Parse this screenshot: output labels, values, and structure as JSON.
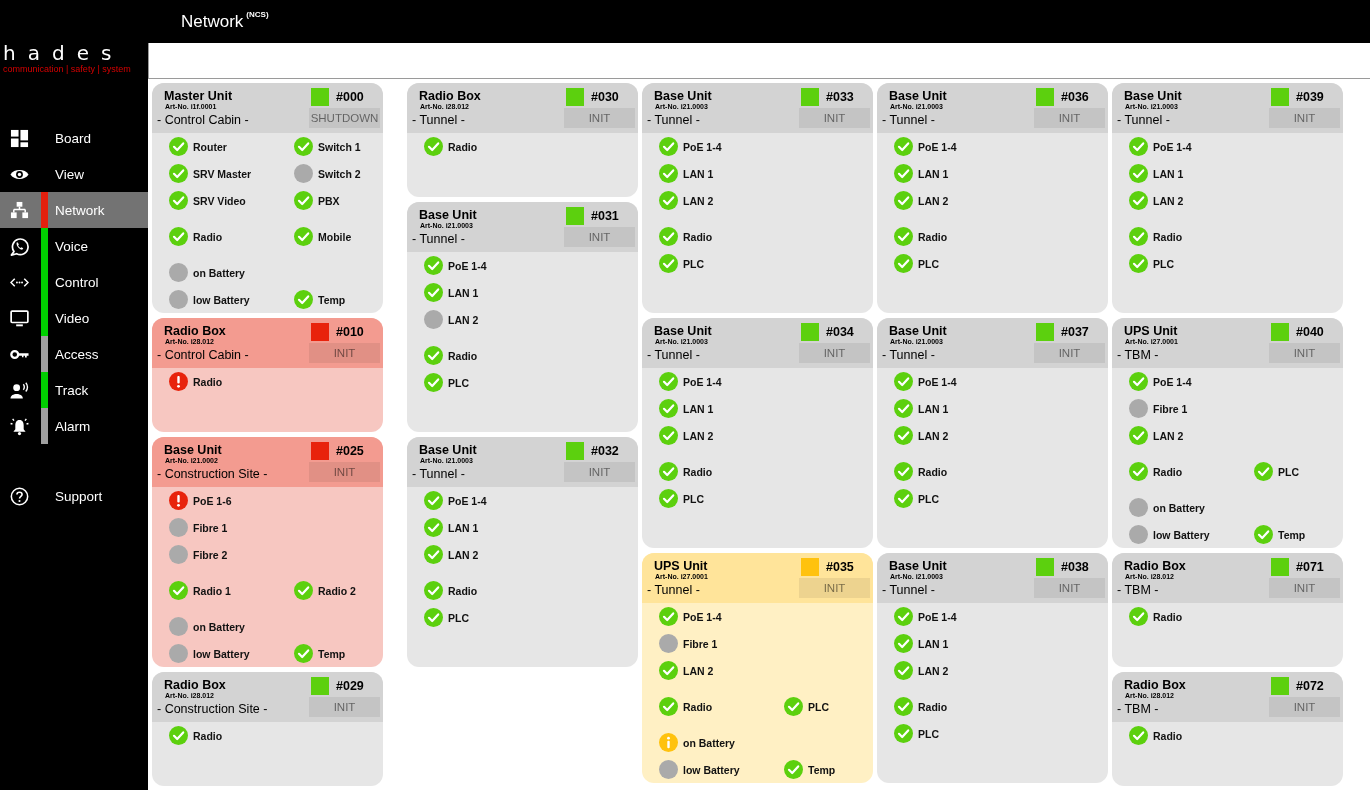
{
  "header": {
    "title": "Network",
    "title_suffix": "(NCS)"
  },
  "sidebar": {
    "logo": {
      "wordmark": "hades",
      "tagline": "communication | safety | system"
    },
    "items": [
      {
        "label": "Board",
        "selected": false
      },
      {
        "label": "View",
        "selected": false
      },
      {
        "label": "Network",
        "selected": true,
        "color": "#e3200e"
      },
      {
        "label": "Voice",
        "selected": false,
        "color": "#00d000"
      },
      {
        "label": "Control",
        "selected": false,
        "color": "#00d000"
      },
      {
        "label": "Video",
        "selected": false,
        "color": "#00d000"
      },
      {
        "label": "Access",
        "selected": false,
        "color": "#a0a0a0"
      },
      {
        "label": "Track",
        "selected": false,
        "color": "#00d000"
      },
      {
        "label": "Alarm",
        "selected": false,
        "color": "#a0a0a0"
      }
    ],
    "support": {
      "label": "Support"
    }
  },
  "columns": [
    {
      "cards": [
        {
          "title": "Master Unit",
          "art_no": "Art-No. i1f.0001",
          "location": "- Control Cabin -",
          "number": "#000",
          "kind": "ok",
          "button": "SHUTDOWN",
          "groups": [
            {
              "rows": [
                [
                  {
                    "label": "Router",
                    "kind": "ok"
                  },
                  {
                    "label": "Switch 1",
                    "kind": "ok"
                  }
                ],
                [
                  {
                    "label": "SRV Master",
                    "kind": "ok"
                  },
                  {
                    "label": "Switch 2",
                    "kind": "off"
                  }
                ],
                [
                  {
                    "label": "SRV Video",
                    "kind": "ok"
                  },
                  {
                    "label": "PBX",
                    "kind": "ok"
                  }
                ]
              ]
            },
            {
              "rows": [
                [
                  {
                    "label": "Radio",
                    "kind": "ok"
                  },
                  {
                    "label": "Mobile",
                    "kind": "ok"
                  }
                ]
              ]
            },
            {
              "rows": [
                [
                  {
                    "label": "on Battery",
                    "kind": "off"
                  }
                ],
                [
                  {
                    "label": "low Battery",
                    "kind": "off"
                  },
                  {
                    "label": "Temp",
                    "kind": "ok"
                  }
                ]
              ]
            }
          ]
        },
        {
          "title": "Radio Box",
          "art_no": "Art-No. i28.012",
          "location": "- Control Cabin -",
          "number": "#010",
          "kind": "error",
          "button": "INIT",
          "groups": [
            {
              "rows": [
                [
                  {
                    "label": "Radio",
                    "kind": "error"
                  }
                ]
              ]
            }
          ]
        },
        {
          "title": "Base Unit",
          "art_no": "Art-No. i21.0002",
          "location": "- Construction Site -",
          "number": "#025",
          "kind": "error",
          "button": "INIT",
          "groups": [
            {
              "rows": [
                [
                  {
                    "label": "PoE 1-6",
                    "kind": "error"
                  }
                ],
                [
                  {
                    "label": "Fibre 1",
                    "kind": "off"
                  }
                ],
                [
                  {
                    "label": "Fibre 2",
                    "kind": "off"
                  }
                ]
              ]
            },
            {
              "rows": [
                [
                  {
                    "label": "Radio 1",
                    "kind": "ok"
                  },
                  {
                    "label": "Radio 2",
                    "kind": "ok"
                  }
                ]
              ]
            },
            {
              "rows": [
                [
                  {
                    "label": "on Battery",
                    "kind": "off"
                  }
                ],
                [
                  {
                    "label": "low Battery",
                    "kind": "off"
                  },
                  {
                    "label": "Temp",
                    "kind": "ok"
                  }
                ]
              ]
            }
          ]
        },
        {
          "title": "Radio Box",
          "art_no": "Art-No. i28.012",
          "location": "- Construction Site -",
          "number": "#029",
          "kind": "ok",
          "button": "INIT",
          "groups": [
            {
              "rows": [
                [
                  {
                    "label": "Radio",
                    "kind": "ok"
                  }
                ]
              ]
            }
          ]
        }
      ]
    },
    {
      "cards": [
        {
          "title": "Radio Box",
          "art_no": "Art-No. i28.012",
          "location": "- Tunnel -",
          "number": "#030",
          "kind": "ok",
          "button": "INIT",
          "groups": [
            {
              "rows": [
                [
                  {
                    "label": "Radio",
                    "kind": "ok"
                  }
                ]
              ]
            }
          ]
        },
        {
          "title": "Base Unit",
          "art_no": "Art-No. i21.0003",
          "location": "- Tunnel -",
          "number": "#031",
          "kind": "ok",
          "button": "INIT",
          "groups": [
            {
              "rows": [
                [
                  {
                    "label": "PoE 1-4",
                    "kind": "ok"
                  }
                ],
                [
                  {
                    "label": "LAN 1",
                    "kind": "ok"
                  }
                ],
                [
                  {
                    "label": "LAN 2",
                    "kind": "off"
                  }
                ]
              ]
            },
            {
              "rows": [
                [
                  {
                    "label": "Radio",
                    "kind": "ok"
                  }
                ],
                [
                  {
                    "label": "PLC",
                    "kind": "ok"
                  }
                ]
              ]
            }
          ]
        },
        {
          "title": "Base Unit",
          "art_no": "Art-No. i21.0003",
          "location": "- Tunnel -",
          "number": "#032",
          "kind": "ok",
          "button": "INIT",
          "groups": [
            {
              "rows": [
                [
                  {
                    "label": "PoE 1-4",
                    "kind": "ok"
                  }
                ],
                [
                  {
                    "label": "LAN 1",
                    "kind": "ok"
                  }
                ],
                [
                  {
                    "label": "LAN 2",
                    "kind": "ok"
                  }
                ]
              ]
            },
            {
              "rows": [
                [
                  {
                    "label": "Radio",
                    "kind": "ok"
                  }
                ],
                [
                  {
                    "label": "PLC",
                    "kind": "ok"
                  }
                ]
              ]
            }
          ]
        }
      ]
    },
    {
      "cards": [
        {
          "title": "Base Unit",
          "art_no": "Art-No. i21.0003",
          "location": "- Tunnel -",
          "number": "#033",
          "kind": "ok",
          "button": "INIT",
          "groups": [
            {
              "rows": [
                [
                  {
                    "label": "PoE 1-4",
                    "kind": "ok"
                  }
                ],
                [
                  {
                    "label": "LAN 1",
                    "kind": "ok"
                  }
                ],
                [
                  {
                    "label": "LAN 2",
                    "kind": "ok"
                  }
                ]
              ]
            },
            {
              "rows": [
                [
                  {
                    "label": "Radio",
                    "kind": "ok"
                  }
                ],
                [
                  {
                    "label": "PLC",
                    "kind": "ok"
                  }
                ]
              ]
            }
          ]
        },
        {
          "title": "Base Unit",
          "art_no": "Art-No. i21.0003",
          "location": "- Tunnel -",
          "number": "#034",
          "kind": "ok",
          "button": "INIT",
          "groups": [
            {
              "rows": [
                [
                  {
                    "label": "PoE 1-4",
                    "kind": "ok"
                  }
                ],
                [
                  {
                    "label": "LAN 1",
                    "kind": "ok"
                  }
                ],
                [
                  {
                    "label": "LAN 2",
                    "kind": "ok"
                  }
                ]
              ]
            },
            {
              "rows": [
                [
                  {
                    "label": "Radio",
                    "kind": "ok"
                  }
                ],
                [
                  {
                    "label": "PLC",
                    "kind": "ok"
                  }
                ]
              ]
            }
          ]
        },
        {
          "title": "UPS Unit",
          "art_no": "Art-No. i27.0001",
          "location": "- Tunnel -",
          "number": "#035",
          "kind": "warning",
          "button": "INIT",
          "groups": [
            {
              "rows": [
                [
                  {
                    "label": "PoE 1-4",
                    "kind": "ok"
                  }
                ],
                [
                  {
                    "label": "Fibre 1",
                    "kind": "off"
                  }
                ],
                [
                  {
                    "label": "LAN 2",
                    "kind": "ok"
                  }
                ]
              ]
            },
            {
              "rows": [
                [
                  {
                    "label": "Radio",
                    "kind": "ok"
                  },
                  {
                    "label": "PLC",
                    "kind": "ok"
                  }
                ]
              ]
            },
            {
              "rows": [
                [
                  {
                    "label": "on Battery",
                    "kind": "warning"
                  }
                ],
                [
                  {
                    "label": "low Battery",
                    "kind": "off"
                  },
                  {
                    "label": "Temp",
                    "kind": "ok"
                  }
                ]
              ]
            }
          ]
        }
      ]
    },
    {
      "cards": [
        {
          "title": "Base Unit",
          "art_no": "Art-No. i21.0003",
          "location": "- Tunnel -",
          "number": "#036",
          "kind": "ok",
          "button": "INIT",
          "groups": [
            {
              "rows": [
                [
                  {
                    "label": "PoE 1-4",
                    "kind": "ok"
                  }
                ],
                [
                  {
                    "label": "LAN 1",
                    "kind": "ok"
                  }
                ],
                [
                  {
                    "label": "LAN 2",
                    "kind": "ok"
                  }
                ]
              ]
            },
            {
              "rows": [
                [
                  {
                    "label": "Radio",
                    "kind": "ok"
                  }
                ],
                [
                  {
                    "label": "PLC",
                    "kind": "ok"
                  }
                ]
              ]
            }
          ]
        },
        {
          "title": "Base Unit",
          "art_no": "Art-No. i21.0003",
          "location": "- Tunnel -",
          "number": "#037",
          "kind": "ok",
          "button": "INIT",
          "groups": [
            {
              "rows": [
                [
                  {
                    "label": "PoE 1-4",
                    "kind": "ok"
                  }
                ],
                [
                  {
                    "label": "LAN 1",
                    "kind": "ok"
                  }
                ],
                [
                  {
                    "label": "LAN 2",
                    "kind": "ok"
                  }
                ]
              ]
            },
            {
              "rows": [
                [
                  {
                    "label": "Radio",
                    "kind": "ok"
                  }
                ],
                [
                  {
                    "label": "PLC",
                    "kind": "ok"
                  }
                ]
              ]
            }
          ]
        },
        {
          "title": "Base Unit",
          "art_no": "Art-No. i21.0003",
          "location": "- Tunnel -",
          "number": "#038",
          "kind": "ok",
          "button": "INIT",
          "groups": [
            {
              "rows": [
                [
                  {
                    "label": "PoE 1-4",
                    "kind": "ok"
                  }
                ],
                [
                  {
                    "label": "LAN 1",
                    "kind": "ok"
                  }
                ],
                [
                  {
                    "label": "LAN 2",
                    "kind": "ok"
                  }
                ]
              ]
            },
            {
              "rows": [
                [
                  {
                    "label": "Radio",
                    "kind": "ok"
                  }
                ],
                [
                  {
                    "label": "PLC",
                    "kind": "ok"
                  }
                ]
              ]
            }
          ]
        }
      ]
    },
    {
      "cards": [
        {
          "title": "Base Unit",
          "art_no": "Art-No. i21.0003",
          "location": "- Tunnel -",
          "number": "#039",
          "kind": "ok",
          "button": "INIT",
          "groups": [
            {
              "rows": [
                [
                  {
                    "label": "PoE 1-4",
                    "kind": "ok"
                  }
                ],
                [
                  {
                    "label": "LAN 1",
                    "kind": "ok"
                  }
                ],
                [
                  {
                    "label": "LAN 2",
                    "kind": "ok"
                  }
                ]
              ]
            },
            {
              "rows": [
                [
                  {
                    "label": "Radio",
                    "kind": "ok"
                  }
                ],
                [
                  {
                    "label": "PLC",
                    "kind": "ok"
                  }
                ]
              ]
            }
          ]
        },
        {
          "title": "UPS Unit",
          "art_no": "Art-No. i27.0001",
          "location": "- TBM -",
          "number": "#040",
          "kind": "ok",
          "button": "INIT",
          "groups": [
            {
              "rows": [
                [
                  {
                    "label": "PoE 1-4",
                    "kind": "ok"
                  }
                ],
                [
                  {
                    "label": "Fibre 1",
                    "kind": "off"
                  }
                ],
                [
                  {
                    "label": "LAN 2",
                    "kind": "ok"
                  }
                ]
              ]
            },
            {
              "rows": [
                [
                  {
                    "label": "Radio",
                    "kind": "ok"
                  },
                  {
                    "label": "PLC",
                    "kind": "ok"
                  }
                ]
              ]
            },
            {
              "rows": [
                [
                  {
                    "label": "on Battery",
                    "kind": "off"
                  }
                ],
                [
                  {
                    "label": "low Battery",
                    "kind": "off"
                  },
                  {
                    "label": "Temp",
                    "kind": "ok"
                  }
                ]
              ]
            }
          ]
        },
        {
          "title": "Radio Box",
          "art_no": "Art-No. i28.012",
          "location": "- TBM -",
          "number": "#071",
          "kind": "ok",
          "button": "INIT",
          "groups": [
            {
              "rows": [
                [
                  {
                    "label": "Radio",
                    "kind": "ok"
                  }
                ]
              ]
            }
          ]
        },
        {
          "title": "Radio Box",
          "art_no": "Art-No. i28.012",
          "location": "- TBM -",
          "number": "#072",
          "kind": "ok",
          "button": "INIT",
          "groups": [
            {
              "rows": [
                [
                  {
                    "label": "Radio",
                    "kind": "ok"
                  }
                ]
              ]
            }
          ]
        }
      ]
    }
  ]
}
